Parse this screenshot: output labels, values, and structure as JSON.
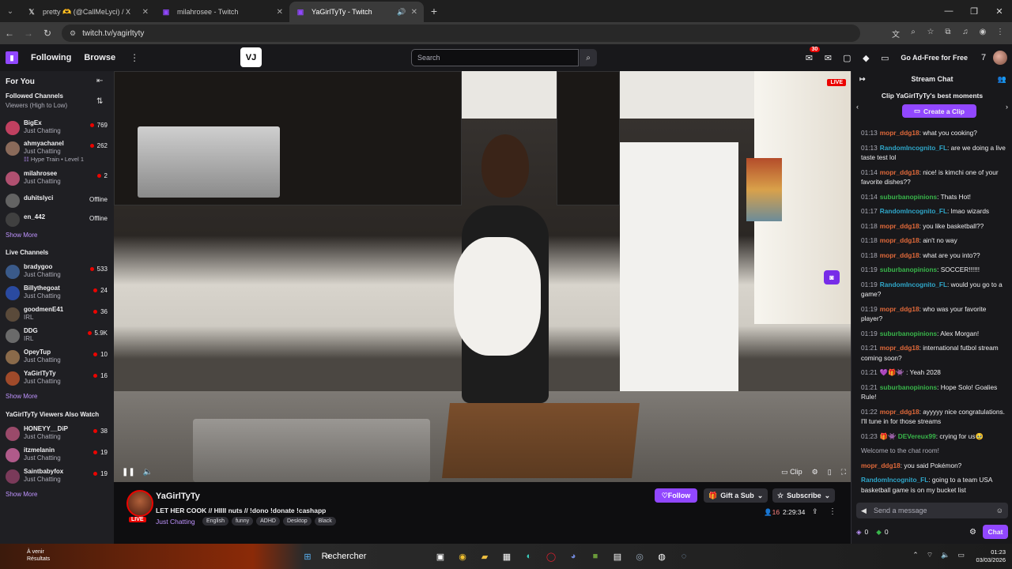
{
  "browser": {
    "tabs": [
      {
        "title": "pretty 🫶 (@CallMeLyci) / X",
        "icon": "x-icon"
      },
      {
        "title": "milahrosee - Twitch",
        "icon": "twitch-icon"
      },
      {
        "title": "YaGirlTyTy - Twitch",
        "icon": "twitch-icon",
        "active": true
      }
    ],
    "url": "twitch.tv/yagirltyty"
  },
  "header": {
    "following": "Following",
    "browse": "Browse",
    "search_placeholder": "Search",
    "notif_count": "30",
    "ad_free": "Go Ad-Free for Free"
  },
  "sidebar": {
    "title": "For You",
    "followed_title": "Followed Channels",
    "followed_sort": "Viewers (High to Low)",
    "followed": [
      {
        "name": "BigEx",
        "category": "Just Chatting",
        "viewers": "769",
        "color": "#c04060"
      },
      {
        "name": "ahmyachanel",
        "category": "Just Chatting",
        "viewers": "262",
        "extra": "Hype Train • Level 1",
        "color": "#8a6a5a"
      },
      {
        "name": "milahrosee",
        "category": "Just Chatting",
        "viewers": "2",
        "color": "#b05070"
      },
      {
        "name": "duhitslyci",
        "category": "",
        "viewers": "Offline",
        "color": "#706060"
      },
      {
        "name": "en_442",
        "category": "",
        "viewers": "Offline",
        "color": "#404040"
      }
    ],
    "show_more": "Show More",
    "live_title": "Live Channels",
    "live": [
      {
        "name": "bradygoo",
        "category": "Just Chatting",
        "viewers": "533",
        "color": "#3a5a8a"
      },
      {
        "name": "Billythegoat",
        "category": "Just Chatting",
        "viewers": "24",
        "color": "#2a4aa0"
      },
      {
        "name": "goodmenE41",
        "category": "IRL",
        "viewers": "36",
        "color": "#5a4a3a"
      },
      {
        "name": "DDG",
        "category": "IRL",
        "viewers": "5.9K",
        "color": "#6a6a6a"
      },
      {
        "name": "OpeyTup",
        "category": "Just Chatting",
        "viewers": "10",
        "color": "#8a6a4a"
      },
      {
        "name": "YaGirlTyTy",
        "category": "Just Chatting",
        "viewers": "16",
        "color": "#a04a2a"
      }
    ],
    "also_title": "YaGirlTyTy Viewers Also Watch",
    "also": [
      {
        "name": "HONEYY__DiP",
        "category": "Just Chatting",
        "viewers": "38",
        "color": "#9a4a6a"
      },
      {
        "name": "itzmelanin",
        "category": "Just Chatting",
        "viewers": "19",
        "color": "#b05a8a"
      },
      {
        "name": "Saintbabyfox",
        "category": "Just Chatting",
        "viewers": "19",
        "color": "#7a3a5a"
      }
    ]
  },
  "player": {
    "live": "LIVE",
    "clip": "Clip"
  },
  "stream": {
    "name": "YaGirlTyTy",
    "title": "LET HER COOK // HIIII nuts // !dono !donate !cashapp",
    "category": "Just Chatting",
    "tags": [
      "English",
      "funny",
      "ADHD",
      "Desktop",
      "Black"
    ],
    "live": "LIVE",
    "follow": "Follow",
    "gift": "Gift a Sub",
    "subscribe": "Subscribe",
    "viewers": "16",
    "uptime": "2:29:34"
  },
  "chat": {
    "header": "Stream Chat",
    "clip_title": "Clip YaGirlTyTy's best moments",
    "clip_button": "Create a Clip",
    "messages": [
      {
        "ts": "01:13",
        "user": "mopr_ddg18",
        "color": "#e0693a",
        "text": "what you cooking?"
      },
      {
        "ts": "01:13",
        "user": "RandomIncognito_FL",
        "color": "#2fa6c9",
        "text": "are we doing a live taste test lol"
      },
      {
        "ts": "01:14",
        "user": "mopr_ddg18",
        "color": "#e0693a",
        "text": "nice! is kimchi one of your favorite dishes??"
      },
      {
        "ts": "01:14",
        "user": "suburbanopinions",
        "color": "#38b54a",
        "text": "Thats Hot!"
      },
      {
        "ts": "01:17",
        "user": "RandomIncognito_FL",
        "color": "#2fa6c9",
        "text": "lmao wizards"
      },
      {
        "ts": "01:18",
        "user": "mopr_ddg18",
        "color": "#e0693a",
        "text": "you like basketball??"
      },
      {
        "ts": "01:18",
        "user": "mopr_ddg18",
        "color": "#e0693a",
        "text": "ain't no way"
      },
      {
        "ts": "01:18",
        "user": "mopr_ddg18",
        "color": "#e0693a",
        "text": "what are you into??"
      },
      {
        "ts": "01:19",
        "user": "suburbanopinions",
        "color": "#38b54a",
        "text": "SOCCER!!!!!!"
      },
      {
        "ts": "01:19",
        "user": "RandomIncognito_FL",
        "color": "#2fa6c9",
        "text": "would you go to a game?"
      },
      {
        "ts": "01:19",
        "user": "mopr_ddg18",
        "color": "#e0693a",
        "text": "who was your favorite player?"
      },
      {
        "ts": "01:19",
        "user": "suburbanopinions",
        "color": "#38b54a",
        "text": "Alex Morgan!"
      },
      {
        "ts": "01:21",
        "user": "mopr_ddg18",
        "color": "#e0693a",
        "text": "international futbol stream coming soon?"
      },
      {
        "ts": "01:21",
        "user": "💜🎁👾 ",
        "color": "#3a3ad0",
        "text": "Yeah 2028"
      },
      {
        "ts": "01:21",
        "user": "suburbanopinions",
        "color": "#38b54a",
        "text": "Hope Solo! Goalies Rule!"
      },
      {
        "ts": "01:22",
        "user": "mopr_ddg18",
        "color": "#e0693a",
        "text": "ayyyyy nice congratulations. I'll tune in for those streams"
      },
      {
        "ts": "01:23",
        "user": "🎁👾 DEVereux99",
        "color": "#38b54a",
        "text": "crying for us🥹"
      },
      {
        "ts": "",
        "user": "",
        "color": "#adadb8",
        "text": "Welcome to the chat room!",
        "system": true
      },
      {
        "ts": "",
        "user": "mopr_ddg18",
        "color": "#e0693a",
        "text": "you said Pokémon?"
      },
      {
        "ts": "",
        "user": "RandomIncognito_FL",
        "color": "#2fa6c9",
        "text": "going to a team USA basketball game is on my bucket list"
      }
    ],
    "input_placeholder": "Send a message",
    "points_a": "0",
    "points_b": "0",
    "chat_button": "Chat"
  },
  "taskbar": {
    "weather_line1": "À venir",
    "weather_line2": "Résultats",
    "search": "Rechercher",
    "time": "01:23",
    "date": "03/03/2026"
  }
}
